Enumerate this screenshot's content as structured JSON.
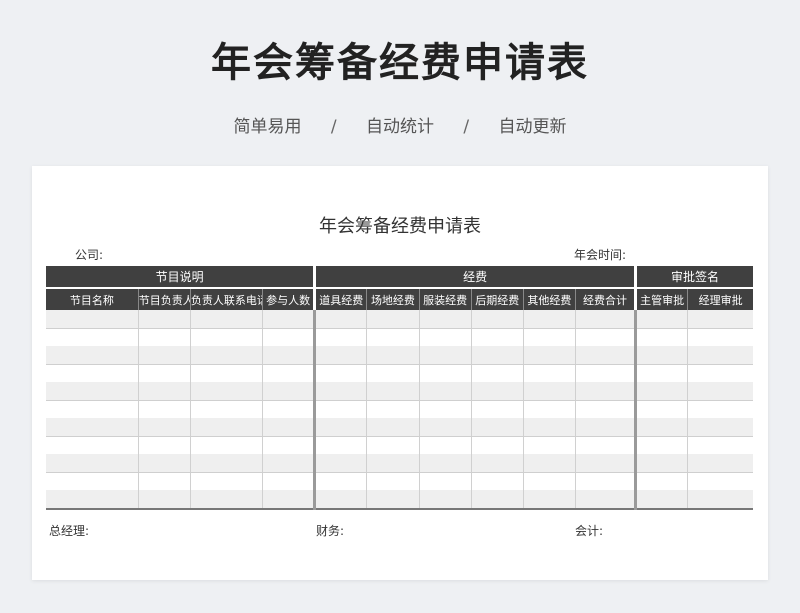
{
  "hero": {
    "title": "年会筹备经费申请表",
    "tags": [
      "简单易用",
      "自动统计",
      "自动更新"
    ],
    "separator": "/"
  },
  "sheet": {
    "title": "年会筹备经费申请表",
    "company_label": "公司:",
    "party_time_label": "年会时间:",
    "groups": [
      "节目说明",
      "经费",
      "审批签名"
    ],
    "columns": [
      "节目名称",
      "节目负责人",
      "负责人联系电话",
      "参与人数",
      "道具经费",
      "场地经费",
      "服装经费",
      "后期经费",
      "其他经费",
      "经费合计",
      "主管审批",
      "经理审批"
    ],
    "signatures": {
      "general_manager": "总经理:",
      "finance": "财务:",
      "accountant": "会计:"
    }
  }
}
